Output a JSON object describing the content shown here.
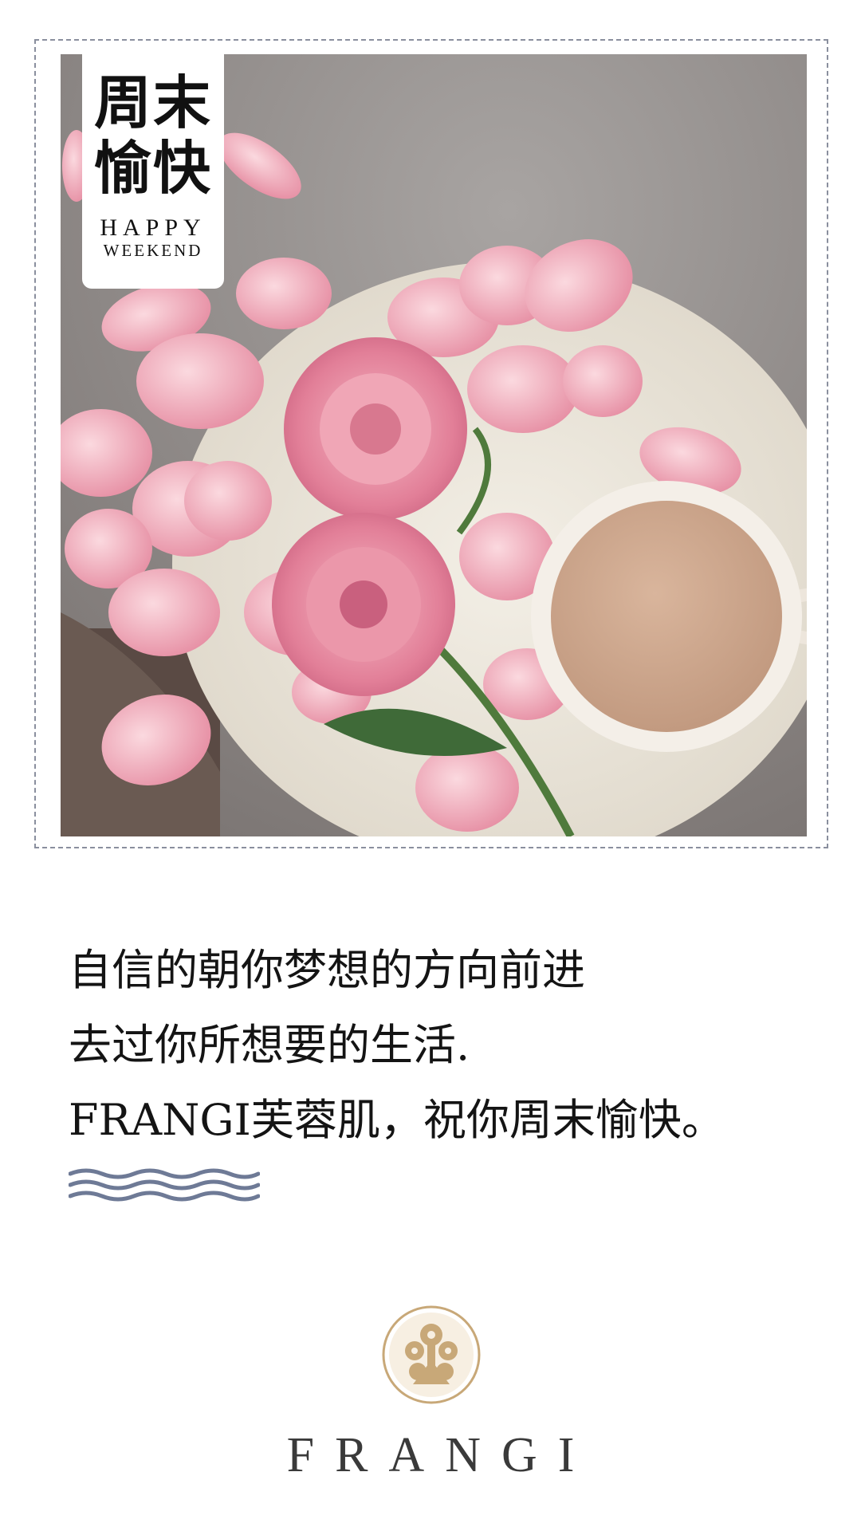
{
  "badge": {
    "title_cn": "周末\n愉快",
    "title_en_line1": "HAPPY",
    "title_en_line2": "WEEKEND"
  },
  "photo": {
    "icon": "rose-tea-photo"
  },
  "quote": {
    "lines": [
      "自信的朝你梦想的方向前进",
      "去过你所想要的生活.",
      "FRANGI芙蓉肌，祝你周末愉快。"
    ]
  },
  "decor": {
    "icon": "wave-lines-icon",
    "color": "#6e7a96"
  },
  "brand": {
    "name": "FRANGI",
    "logo_icon": "frangi-emblem-icon",
    "gold": "#c8a878"
  }
}
